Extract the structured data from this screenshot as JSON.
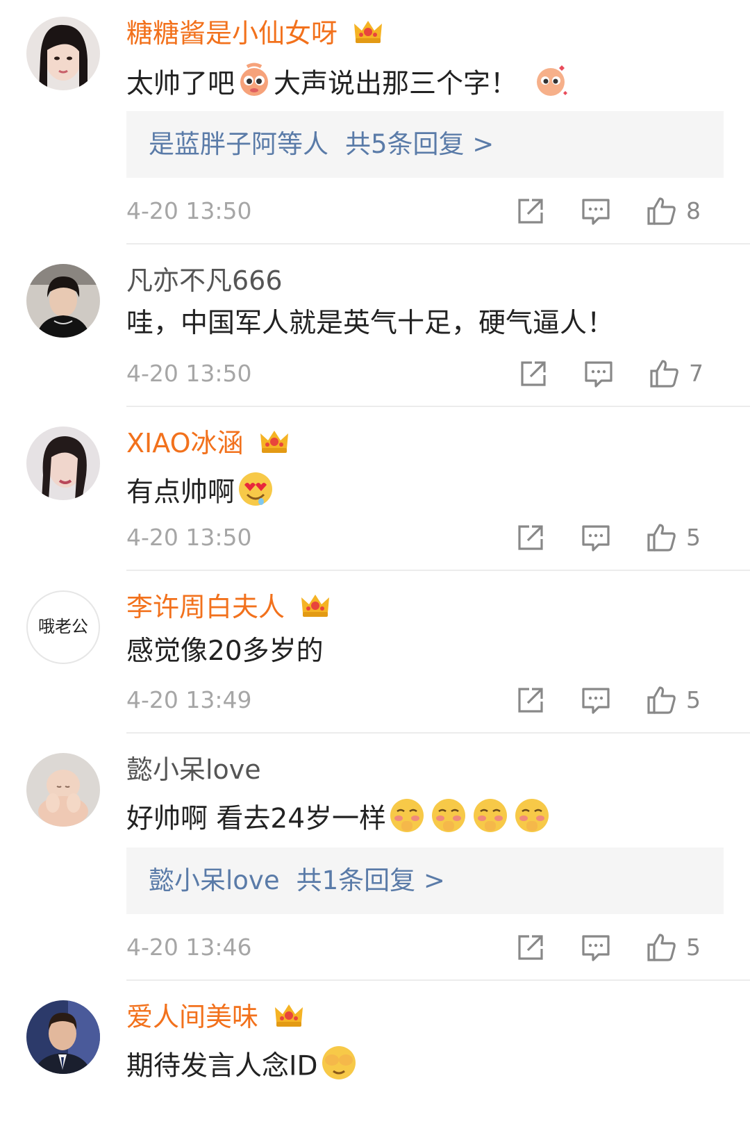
{
  "comments": [
    {
      "username": "糖糖酱是小仙女呀",
      "vip": true,
      "text": "太帅了吧",
      "text2": "大声说出那三个字！",
      "reply": {
        "users": "是蓝胖子阿等人",
        "count": "共5条回复 >"
      },
      "time": "4-20 13:50",
      "likes": "8"
    },
    {
      "username": "凡亦不凡666",
      "vip": false,
      "text": "哇，中国军人就是英气十足，硬气逼人！",
      "time": "4-20 13:50",
      "likes": "7"
    },
    {
      "username": "XIAO冰涵",
      "vip": true,
      "text": "有点帅啊",
      "time": "4-20 13:50",
      "likes": "5"
    },
    {
      "username": "李许周白夫人",
      "vip": true,
      "avatar_text": "哦老公",
      "text": "感觉像20多岁的",
      "time": "4-20 13:49",
      "likes": "5"
    },
    {
      "username": "懿小呆love",
      "vip": false,
      "text": "好帅啊 看去24岁一样",
      "reply": {
        "users": "懿小呆love",
        "count": "共1条回复 >"
      },
      "time": "4-20 13:46",
      "likes": "5"
    },
    {
      "username": "爱人间美味",
      "vip": true,
      "text": "期待发言人念ID"
    }
  ],
  "icons": {
    "forward": "share-icon",
    "comment": "comment-icon",
    "like": "thumbs-up-icon",
    "vip": "crown-icon"
  },
  "colors": {
    "vip_name": "#f2711c",
    "normal_name": "#555555",
    "reply_link": "#5a7ba8",
    "reply_bg": "#f5f5f5",
    "meta": "#a6a6a6"
  }
}
